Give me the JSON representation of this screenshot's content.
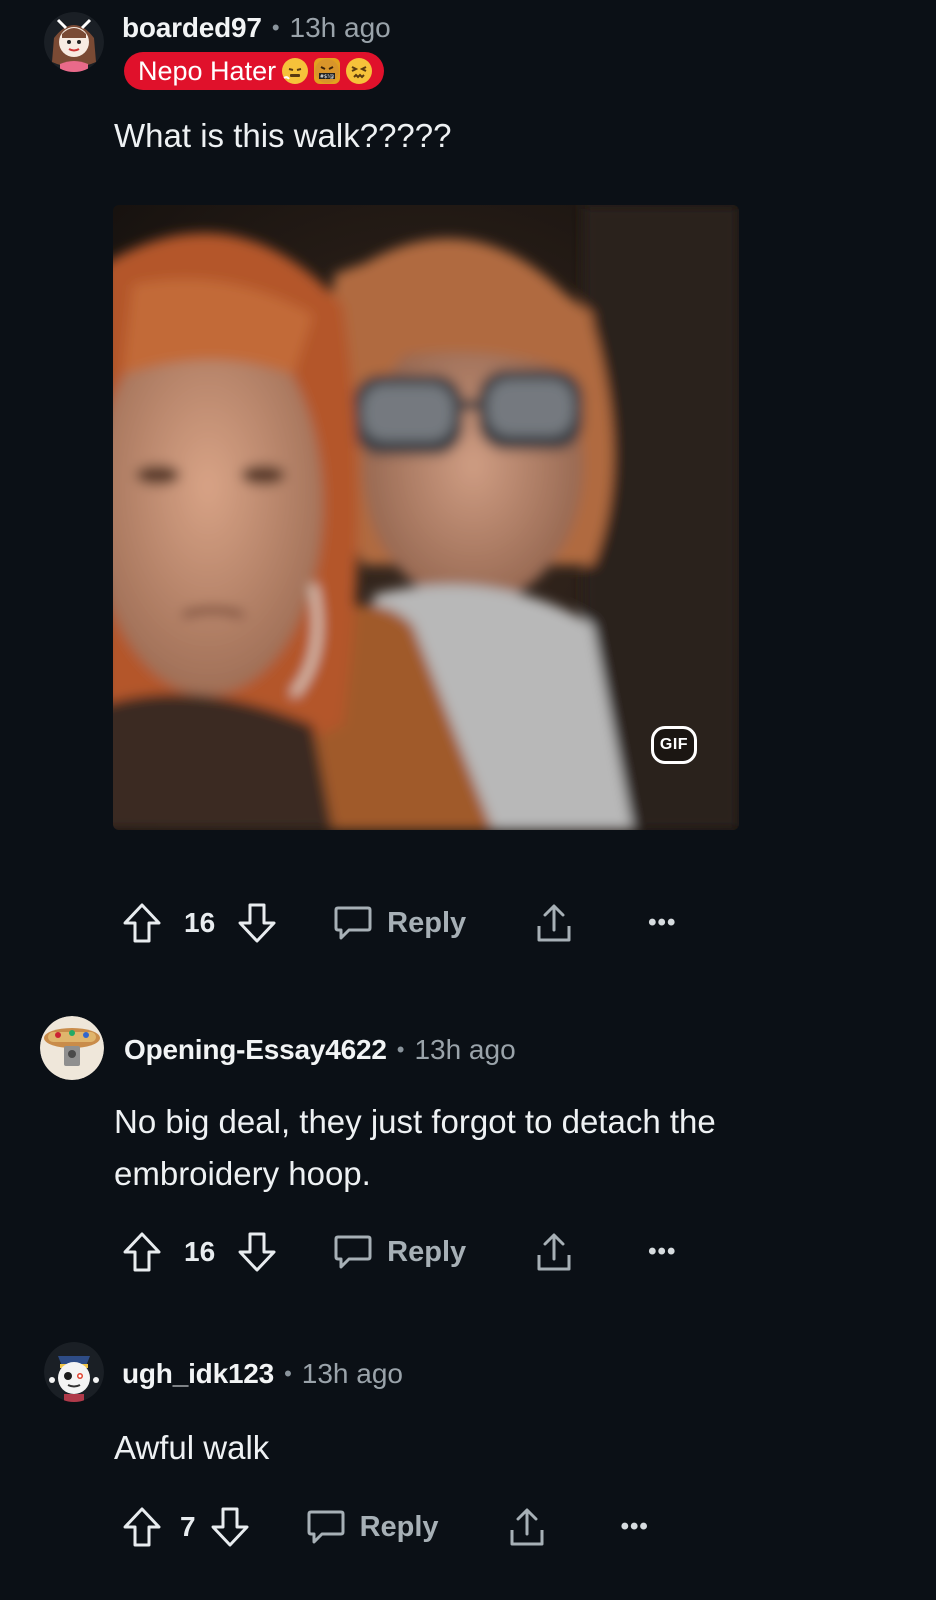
{
  "comments": [
    {
      "username": "boarded97",
      "separator": "•",
      "time": "13h ago",
      "flair": {
        "text": "Nepo Hater",
        "color": "#e0112b",
        "emojis": [
          "triumph-emoji",
          "cursing-emoji",
          "confounded-emoji"
        ]
      },
      "text_lines": [
        "What is this walk?????"
      ],
      "media": {
        "type": "gif",
        "badge": "GIF"
      },
      "votes": "16",
      "reply_label": "Reply",
      "more": "•••"
    },
    {
      "username": "Opening-Essay4622",
      "separator": "•",
      "time": "13h ago",
      "text_lines": [
        "No big deal, they just forgot to detach the",
        "embroidery hoop."
      ],
      "votes": "16",
      "reply_label": "Reply",
      "more": "•••"
    },
    {
      "username": "ugh_idk123",
      "separator": "•",
      "time": "13h ago",
      "text_lines": [
        "Awful walk"
      ],
      "votes": "7",
      "reply_label": "Reply",
      "more": "•••"
    }
  ],
  "colors": {
    "background": "#0b1016",
    "text": "#e8ecef",
    "muted": "#9aa3aa",
    "flair": "#e0112b"
  }
}
